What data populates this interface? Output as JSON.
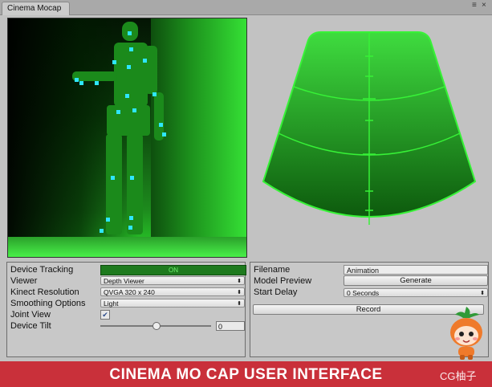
{
  "window": {
    "tab_label": "Cinema Mocap",
    "menu_glyph": "≡",
    "close_glyph": "×"
  },
  "left_panel": {
    "device_tracking": {
      "label": "Device Tracking",
      "value": "ON"
    },
    "viewer": {
      "label": "Viewer",
      "value": "Depth Viewer"
    },
    "kinect_resolution": {
      "label": "Kinect Resolution",
      "value": "QVGA 320 x 240"
    },
    "smoothing_options": {
      "label": "Smoothing Options",
      "value": "Light"
    },
    "joint_view": {
      "label": "Joint View",
      "checked": true,
      "check_glyph": "✔"
    },
    "device_tilt": {
      "label": "Device Tilt",
      "value": "0"
    }
  },
  "right_panel": {
    "filename": {
      "label": "Filename",
      "value": "Animation"
    },
    "model_preview": {
      "label": "Model Preview",
      "button": "Generate"
    },
    "start_delay": {
      "label": "Start Delay",
      "value": "0 Seconds"
    },
    "record_button": "Record"
  },
  "select_arrow_glyph": "⬍",
  "banner": {
    "title": "CINEMA MO CAP USER INTERFACE",
    "watermark": "CG柚子"
  },
  "colors": {
    "accent_green": "#1e7a1e",
    "banner_red": "#c9303a",
    "joint_cyan": "#2ee6ff"
  }
}
